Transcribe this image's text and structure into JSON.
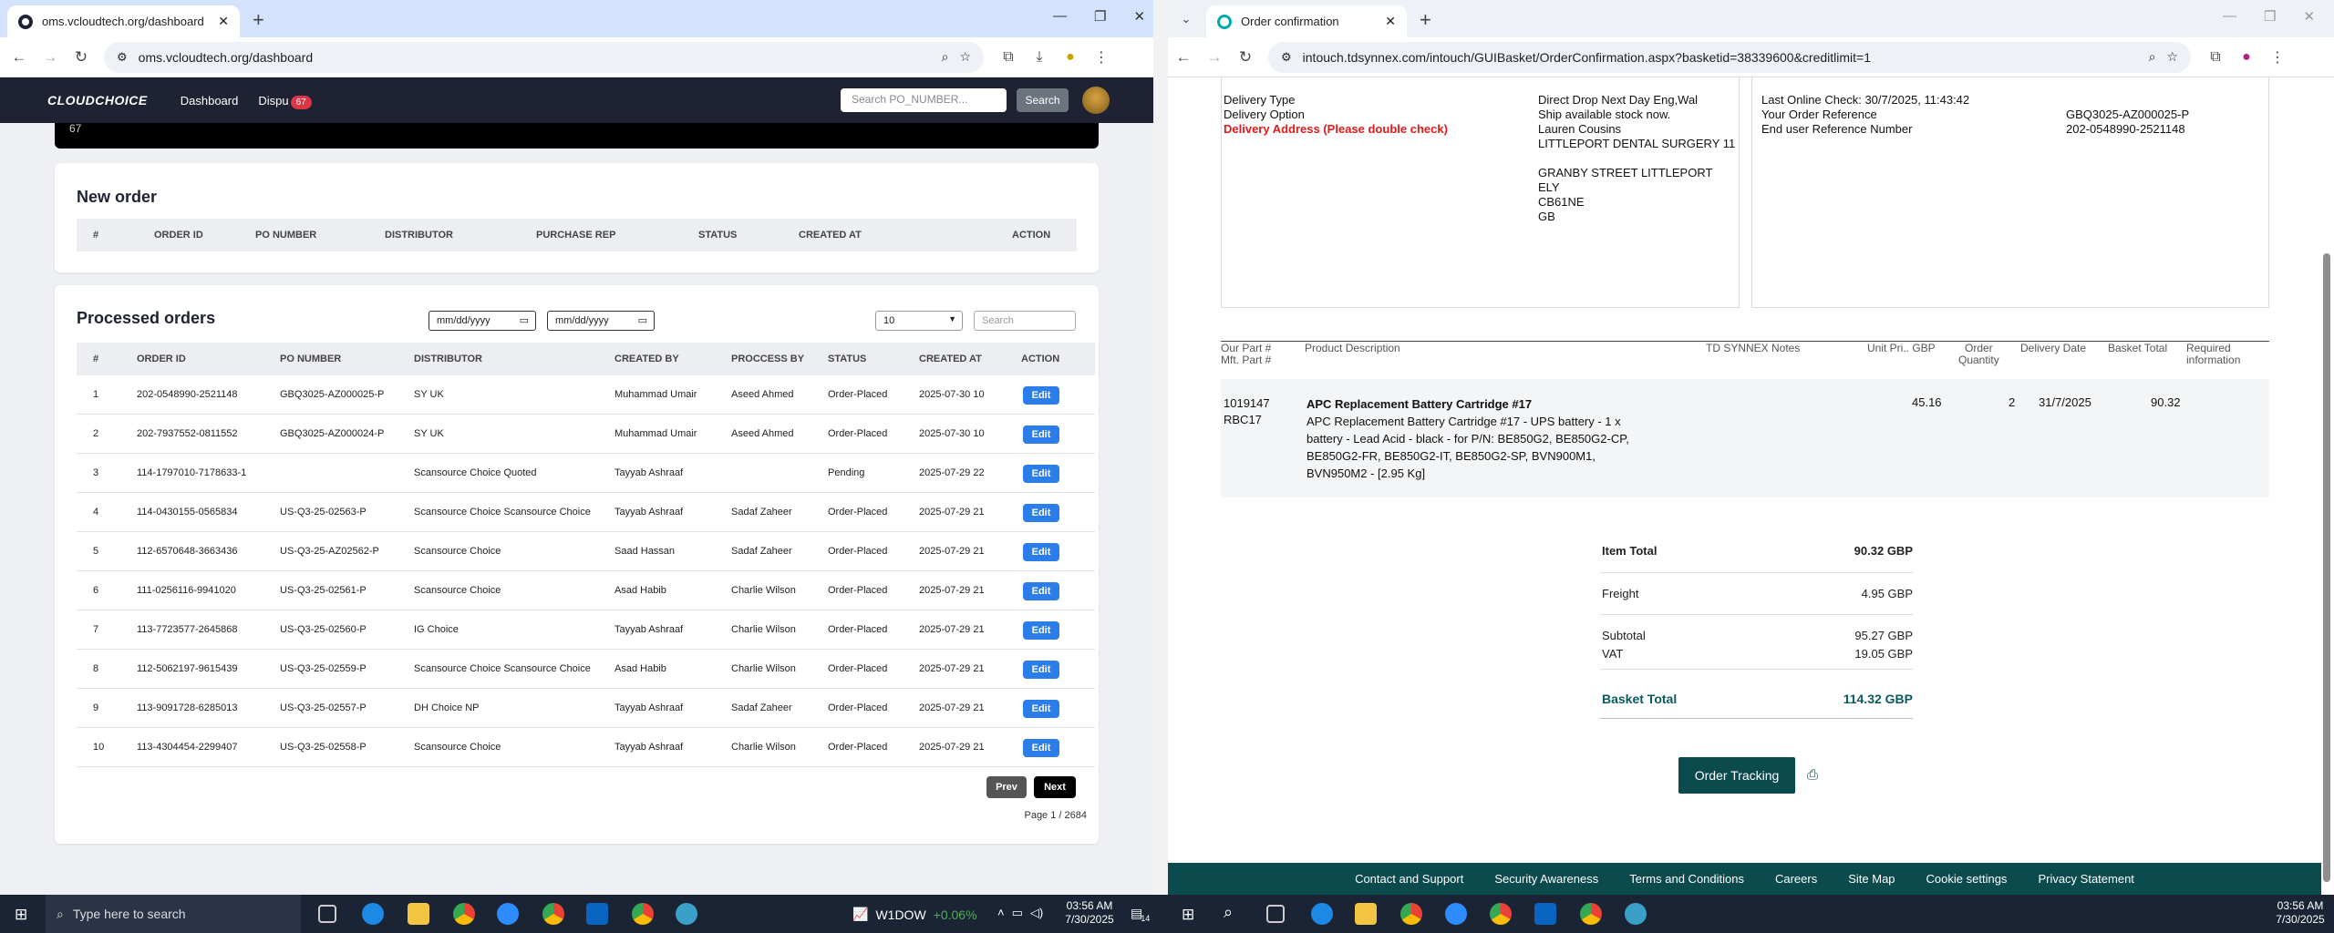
{
  "left_browser": {
    "tab_title": "oms.vcloudtech.org/dashboard",
    "url": "oms.vcloudtech.org/dashboard"
  },
  "oms": {
    "logo": "CLOUDCHOICE",
    "nav": {
      "dashboard": "Dashboard",
      "disputes": "Dispu",
      "disputes_badge": "67"
    },
    "search_placeholder": "Search PO_NUMBER...",
    "search_button": "Search",
    "top_count": "67",
    "new_order": {
      "title": "New order",
      "columns": [
        "#",
        "ORDER ID",
        "PO NUMBER",
        "DISTRIBUTOR",
        "PURCHASE REP",
        "STATUS",
        "CREATED AT",
        "ACTION"
      ]
    },
    "processed": {
      "title": "Processed orders",
      "date_from": "mm/dd/yyyy",
      "date_to": "mm/dd/yyyy",
      "page_size": "10",
      "search_placeholder": "Search",
      "columns": [
        "#",
        "ORDER ID",
        "PO NUMBER",
        "DISTRIBUTOR",
        "CREATED BY",
        "PROCCESS BY",
        "STATUS",
        "CREATED AT",
        "ACTION"
      ],
      "rows": [
        {
          "n": "1",
          "order_id": "202-0548990-2521148",
          "po": "GBQ3025-AZ000025-P",
          "distributor": "SY UK",
          "created_by": "Muhammad Umair",
          "process_by": "Aseed Ahmed",
          "status": "Order-Placed",
          "created_at": "2025-07-30 10",
          "action": "Edit"
        },
        {
          "n": "2",
          "order_id": "202-7937552-0811552",
          "po": "GBQ3025-AZ000024-P",
          "distributor": "SY UK",
          "created_by": "Muhammad Umair",
          "process_by": "Aseed Ahmed",
          "status": "Order-Placed",
          "created_at": "2025-07-30 10",
          "action": "Edit"
        },
        {
          "n": "3",
          "order_id": "114-1797010-7178633-1",
          "po": "",
          "distributor": "Scansource Choice Quoted",
          "created_by": "Tayyab Ashraaf",
          "process_by": "",
          "status": "Pending",
          "created_at": "2025-07-29 22",
          "action": "Edit"
        },
        {
          "n": "4",
          "order_id": "114-0430155-0565834",
          "po": "US-Q3-25-02563-P",
          "distributor": "Scansource Choice Scansource Choice",
          "created_by": "Tayyab Ashraaf",
          "process_by": "Sadaf Zaheer",
          "status": "Order-Placed",
          "created_at": "2025-07-29 21",
          "action": "Edit"
        },
        {
          "n": "5",
          "order_id": "112-6570648-3663436",
          "po": "US-Q3-25-AZ02562-P",
          "distributor": "Scansource Choice",
          "created_by": "Saad Hassan",
          "process_by": "Sadaf Zaheer",
          "status": "Order-Placed",
          "created_at": "2025-07-29 21",
          "action": "Edit"
        },
        {
          "n": "6",
          "order_id": "111-0256116-9941020",
          "po": "US-Q3-25-02561-P",
          "distributor": "Scansource Choice",
          "created_by": "Asad Habib",
          "process_by": "Charlie Wilson",
          "status": "Order-Placed",
          "created_at": "2025-07-29 21",
          "action": "Edit"
        },
        {
          "n": "7",
          "order_id": "113-7723577-2645868",
          "po": "US-Q3-25-02560-P",
          "distributor": "IG Choice",
          "created_by": "Tayyab Ashraaf",
          "process_by": "Charlie Wilson",
          "status": "Order-Placed",
          "created_at": "2025-07-29 21",
          "action": "Edit"
        },
        {
          "n": "8",
          "order_id": "112-5062197-9615439",
          "po": "US-Q3-25-02559-P",
          "distributor": "Scansource Choice Scansource Choice",
          "created_by": "Asad Habib",
          "process_by": "Charlie Wilson",
          "status": "Order-Placed",
          "created_at": "2025-07-29 21",
          "action": "Edit"
        },
        {
          "n": "9",
          "order_id": "113-9091728-6285013",
          "po": "US-Q3-25-02557-P",
          "distributor": "DH Choice NP",
          "created_by": "Tayyab Ashraaf",
          "process_by": "Sadaf Zaheer",
          "status": "Order-Placed",
          "created_at": "2025-07-29 21",
          "action": "Edit"
        },
        {
          "n": "10",
          "order_id": "113-4304454-2299407",
          "po": "US-Q3-25-02558-P",
          "distributor": "Scansource Choice",
          "created_by": "Tayyab Ashraaf",
          "process_by": "Charlie Wilson",
          "status": "Order-Placed",
          "created_at": "2025-07-29 21",
          "action": "Edit"
        }
      ],
      "prev": "Prev",
      "next": "Next",
      "page_info": "Page 1 / 2684"
    }
  },
  "right_browser": {
    "tab_title": "Order confirmation",
    "url": "intouch.tdsynnex.com/intouch/GUIBasket/OrderConfirmation.aspx?basketid=38339600&creditlimit=1"
  },
  "confirmation": {
    "labels": [
      "Delivery Type",
      "Delivery Option",
      "Delivery Address (Please double check)"
    ],
    "delivery_values": [
      "Direct Drop Next Day Eng,Wal",
      "Ship available stock now.",
      "Lauren Cousins",
      "LITTLEPORT DENTAL SURGERY 11",
      "",
      "GRANBY STREET LITTLEPORT",
      "ELY",
      "CB61NE",
      "GB"
    ],
    "right_labels": [
      "Last Online Check: 30/7/2025, 11:43:42",
      "Your Order Reference",
      "End user Reference Number"
    ],
    "right_values": [
      "",
      "GBQ3025-AZ000025-P",
      "202-0548990-2521148"
    ],
    "table_headers": {
      "part": [
        "Our Part #",
        "Mft. Part #"
      ],
      "description": "Product Description",
      "notes": "TD SYNNEX Notes",
      "unit_price": "Unit Pri.. GBP",
      "qty": [
        "Order",
        "Quantity"
      ],
      "delivery": "Delivery Date",
      "basket_total": "Basket Total",
      "required": [
        "Required",
        "information"
      ]
    },
    "item": {
      "our_part": "1019147",
      "mft_part": "RBC17",
      "name": "APC Replacement Battery Cartridge #17",
      "desc_lines": [
        "APC Replacement Battery Cartridge #17 - UPS battery - 1 x",
        "battery - Lead Acid - black - for P/N: BE850G2, BE850G2-CP,",
        "BE850G2-FR, BE850G2-IT, BE850G2-SP, BVN900M1,",
        "BVN950M2 - [2.95 Kg]"
      ],
      "unit_price": "45.16",
      "qty": "2",
      "delivery_date": "31/7/2025",
      "total": "90.32"
    },
    "summary": {
      "item_total_label": "Item Total",
      "item_total": "90.32  GBP",
      "freight_label": "Freight",
      "freight": "4.95  GBP",
      "subtotal_label": "Subtotal",
      "subtotal": "95.27  GBP",
      "vat_label": "VAT",
      "vat": "19.05  GBP",
      "basket_total_label": "Basket Total",
      "basket_total": "114.32  GBP"
    },
    "order_tracking": "Order Tracking",
    "footer": [
      "Contact and Support",
      "Security Awareness",
      "Terms and Conditions",
      "Careers",
      "Site Map",
      "Cookie settings",
      "Privacy Statement"
    ]
  },
  "taskbar": {
    "search_placeholder": "Type here to search",
    "stock_name": "W1DOW",
    "stock_change": "+0.06%",
    "time_left": "03:56 AM",
    "date_left": "7/30/2025",
    "notif_count": "14",
    "time_right": "03:56 AM",
    "date_right": "7/30/2025"
  },
  "colors": {
    "nav_dark": "#1f2233",
    "edit_blue": "#2b7de9",
    "teal": "#0b4a4d",
    "taskbar": "#1b2434",
    "address_red": "#e01a1a"
  }
}
